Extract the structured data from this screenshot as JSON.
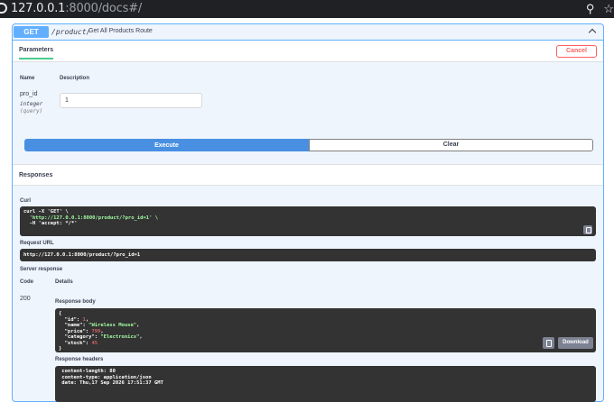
{
  "browser": {
    "url_host": "127.0.0.1",
    "url_path": ":8000/docs#/"
  },
  "operation": {
    "method": "GET",
    "path": "/product/",
    "summary": "Get All Products Route"
  },
  "parameters": {
    "tab_label": "Parameters",
    "cancel_label": "Cancel",
    "col_name": "Name",
    "col_description": "Description",
    "items": [
      {
        "name": "pro_id",
        "type": "integer",
        "in": "(query)",
        "value": "1"
      }
    ]
  },
  "actions": {
    "execute_label": "Execute",
    "clear_label": "Clear"
  },
  "responses": {
    "title": "Responses",
    "curl_label": "Curl",
    "curl_lines": [
      "curl -X 'GET' \\",
      "  'http://127.0.0.1:8000/product/?pro_id=1' \\",
      "  -H 'accept: */*'"
    ],
    "request_url_label": "Request URL",
    "request_url": "http://127.0.0.1:8000/product/?pro_id=1",
    "server_response_label": "Server response",
    "col_code": "Code",
    "col_details": "Details",
    "status_code": "200",
    "body_label": "Response body",
    "body": {
      "id": 1,
      "name": "Wireless Mouse",
      "price": 799,
      "category": "Electronics",
      "stock": 45
    },
    "download_label": "Download",
    "headers_label": "Response headers",
    "headers_lines": [
      " content-length: 80",
      " content-type: application/json",
      " date: Thu,17 Sep 2026 17:51:37 GMT"
    ]
  }
}
